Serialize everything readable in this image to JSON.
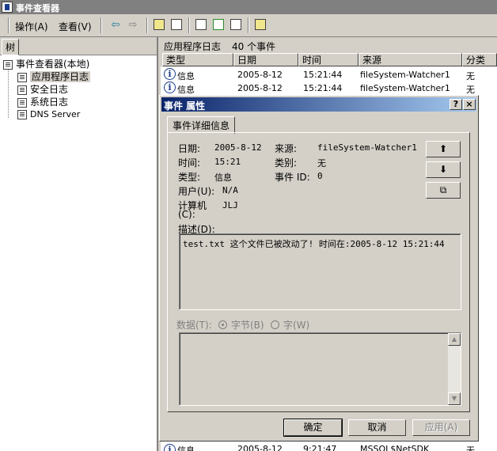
{
  "window": {
    "title": "事件查看器"
  },
  "menu": {
    "action": "操作(A)",
    "view": "查看(V)"
  },
  "toolbar": {
    "icons": [
      "back-arrow-icon",
      "forward-arrow-icon",
      "up-folder-icon",
      "show-hide-tree-icon",
      "properties-icon",
      "refresh-icon",
      "export-list-icon",
      "help-icon"
    ]
  },
  "tree": {
    "tab_label": "树",
    "root": "事件查看器(本地)",
    "items": [
      "应用程序日志",
      "安全日志",
      "系统日志",
      "DNS Server"
    ]
  },
  "list": {
    "title": "应用程序日志",
    "count": "40 个事件",
    "columns": [
      "类型",
      "日期",
      "时间",
      "来源",
      "分类"
    ],
    "rows": [
      {
        "type": "信息",
        "date": "2005-8-12",
        "time": "15:21:44",
        "source": "fileSystem-Watcher1",
        "category": "无"
      },
      {
        "type": "信息",
        "date": "2005-8-12",
        "time": "15:21:44",
        "source": "fileSystem-Watcher1",
        "category": "无"
      },
      {
        "type": "信息",
        "date": "2005-8-12",
        "time": "9:21:47",
        "source": "MSSQL$NetSDK",
        "category": "无"
      }
    ]
  },
  "dialog": {
    "title": "事件 属性",
    "tab": "事件详细信息",
    "date_label": "日期:",
    "date_value": "2005-8-12",
    "source_label": "来源:",
    "source_value": "fileSystem-Watcher1",
    "time_label": "时间:",
    "time_value": "15:21",
    "category_label": "类别:",
    "category_value": "无",
    "type_label": "类型:",
    "type_value": "信息",
    "event_id_label": "事件 ID:",
    "event_id_value": "0",
    "user_label": "用户(U):",
    "user_value": "N/A",
    "computer_label_1": "计算机",
    "computer_label_2": "(C):",
    "computer_value": "JLJ",
    "desc_label": "描述(D):",
    "description": "test.txt 这个文件已被改动了! 时间在:2005-8-12 15:21:44",
    "data_label": "数据(T):",
    "radio_bytes": "字节(B)",
    "radio_words": "字(W)",
    "ok": "确定",
    "cancel": "取消",
    "apply": "应用(A)",
    "help_btn": "?",
    "close_btn": "×"
  }
}
